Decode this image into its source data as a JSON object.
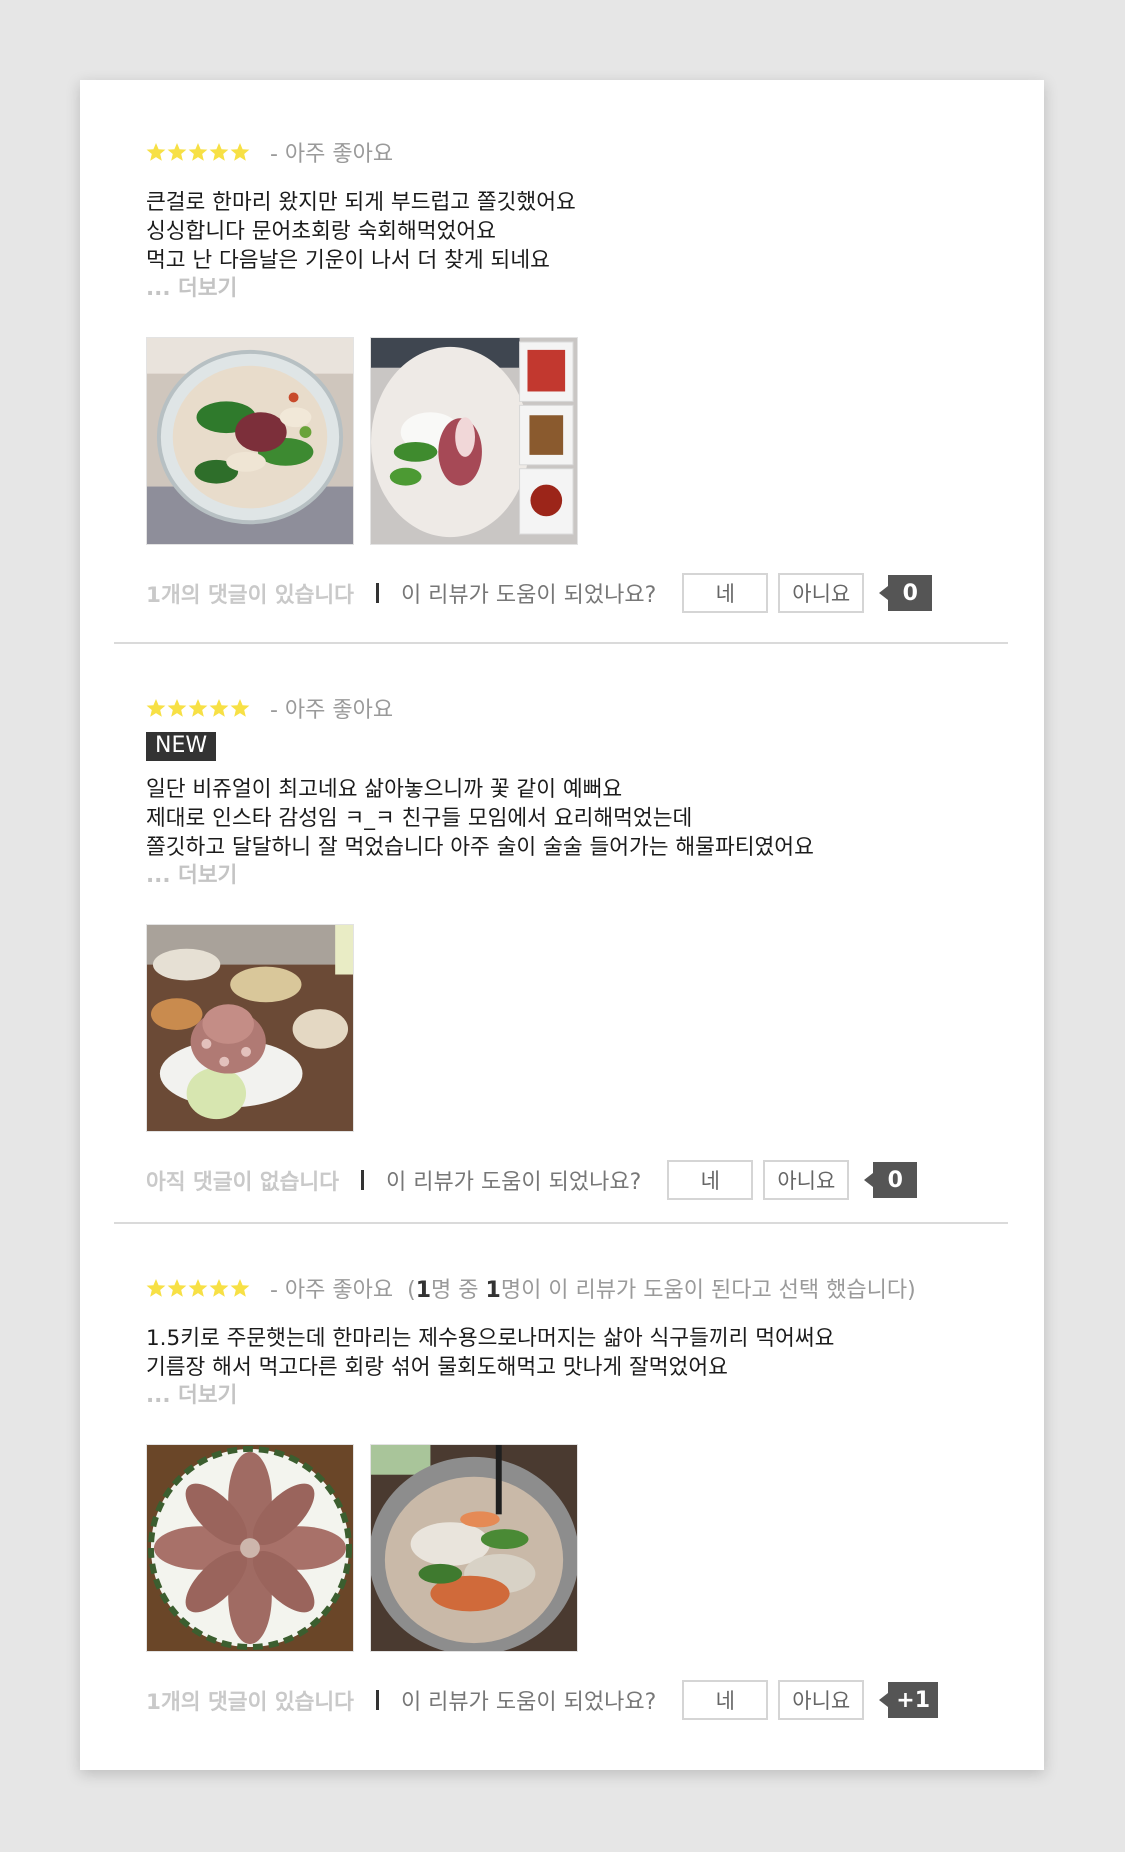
{
  "reviews": [
    {
      "rating_label": "- 아주 좋아요",
      "is_new": false,
      "new_label": "",
      "lines": [
        "큰걸로 한마리 왔지만 되게 부드럽고 쫄깃했어요",
        "싱싱합니다 문어초회랑 숙회해먹었어요",
        "먹고 난 다음날은 기운이 나서 더 찾게 되네요"
      ],
      "more_label": "... 더보기",
      "comments_label": "1개의 댓글이 있습니다",
      "helpful_question": "이 리뷰가 도움이 되었나요?",
      "yes_label": "네",
      "no_label": "아니요",
      "helpful_badge": "0"
    },
    {
      "rating_label": "- 아주 좋아요",
      "is_new": true,
      "new_label": "NEW",
      "lines": [
        "일단 비쥬얼이 최고네요 삶아놓으니까 꽃 같이 예뻐요",
        "제대로 인스타 감성임 ㅋ_ㅋ 친구들 모임에서 요리해먹었는데",
        "쫄깃하고 달달하니 잘 먹었습니다 아주 술이 술술 들어가는 해물파티였어요"
      ],
      "more_label": "... 더보기",
      "comments_label": "아직 댓글이 없습니다",
      "helpful_question": "이 리뷰가 도움이 되었나요?",
      "yes_label": "네",
      "no_label": "아니요",
      "helpful_badge": "0"
    },
    {
      "rating_label": "- 아주 좋아요",
      "helpful_prefix": "(",
      "helpful_n1": "1",
      "helpful_mid": "명 중 ",
      "helpful_n2": "1",
      "helpful_suffix": "명이 이 리뷰가 도움이 된다고 선택 했습니다)",
      "lines": [
        "1.5키로 주문햇는데 한마리는 제수용으로나머지는 삶아 식구들끼리 먹어써요",
        "기름장 해서 먹고다른 회랑 섞어 물회도해먹고 맛나게 잘먹었어요"
      ],
      "more_label": "... 더보기",
      "comments_label": "1개의 댓글이 있습니다",
      "helpful_question": "이 리뷰가 도움이 되었나요?",
      "yes_label": "네",
      "no_label": "아니요",
      "helpful_badge": "+1"
    }
  ],
  "colors": {
    "star": "#f7e045",
    "badge": "#555555",
    "new_badge": "#333333",
    "muted_text": "#9a9a9a"
  },
  "photo_subjects": [
    [
      "octopus-salad-bowl-photo",
      "octopus-sashimi-plate-photo"
    ],
    [
      "whole-boiled-octopus-party-photo"
    ],
    [
      "boiled-octopus-plate-photo",
      "mulhoe-bowl-photo"
    ]
  ]
}
